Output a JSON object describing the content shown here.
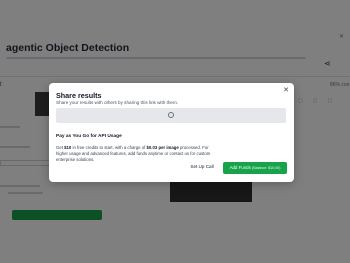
{
  "background": {
    "title": "agentic Object Detection",
    "input_label": "t",
    "output_label": "86% con",
    "share_icon": "share-icon",
    "corner_icon": "close-icon"
  },
  "modal": {
    "title": "Share results",
    "subtitle": "Share your results with others by sharing this link with them.",
    "close_icon": "close-icon",
    "link_loading_icon": "loading-spinner-icon",
    "pricing": {
      "title": "Pay as You Go for API Usage",
      "text_prefix": "Get ",
      "free_credit": "$10",
      "text_mid": " in free credits to start, with a charge of ",
      "charge": "$0.03 per image",
      "text_suffix": " processed. For higher usage and advanced features, add funds anytime or contact us for custom enterprise solutions."
    },
    "buttons": {
      "setup_call": "Set Up Call",
      "add_funds": "Add Funds",
      "balance": "(Balance: $10.00)"
    }
  },
  "colors": {
    "accent": "#16a34a",
    "overlay": "rgba(0,0,0,0.5)"
  }
}
